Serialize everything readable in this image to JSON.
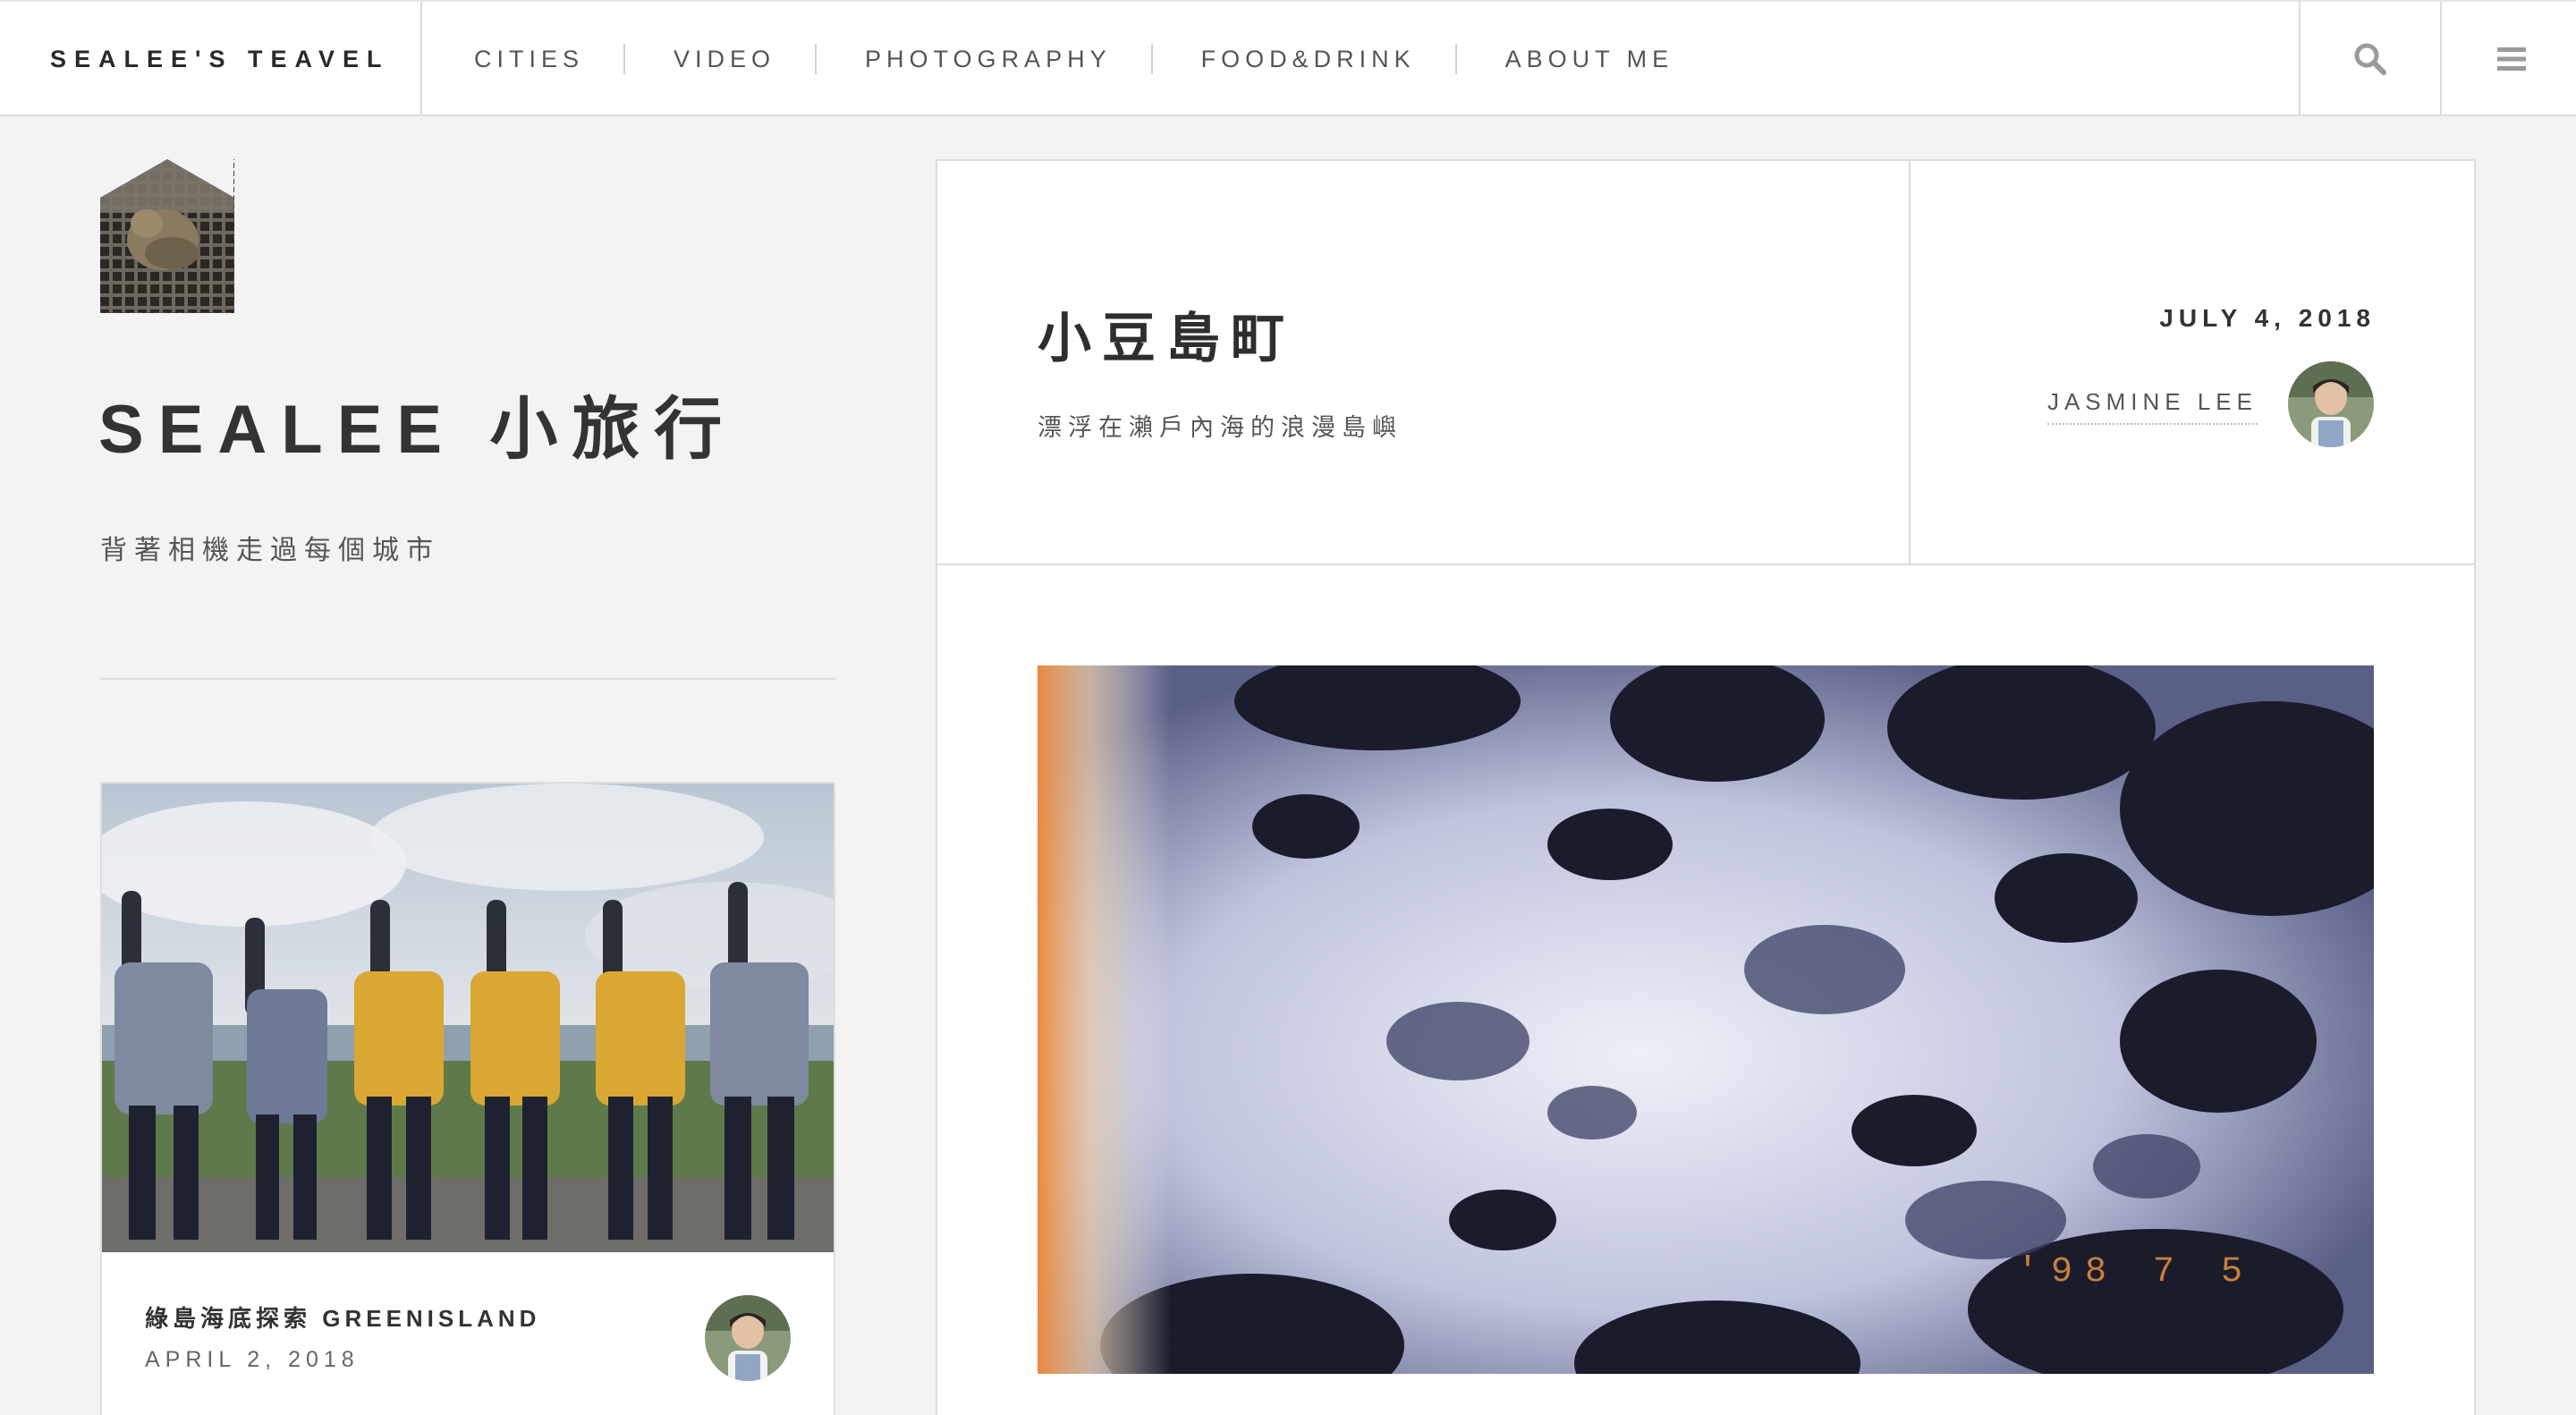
{
  "nav": {
    "brand": "SEALEE'S TEAVEL",
    "items": [
      "CITIES",
      "VIDEO",
      "PHOTOGRAPHY",
      "FOOD&DRINK",
      "ABOUT ME"
    ],
    "search_icon": "search-icon",
    "menu_icon": "hamburger-menu-icon"
  },
  "sidebar": {
    "title": "SEALEE 小旅行",
    "subtitle": "背著相機走過每個城市",
    "card": {
      "title": "綠島海底探索 GREENISLAND",
      "date": "APRIL 2, 2018"
    }
  },
  "post": {
    "title": "小豆島町",
    "subtitle": "漂浮在瀨戶內海的浪漫島嶼",
    "date": "JULY 4, 2018",
    "author": "JASMINE LEE",
    "photo_stamp": "'98 7 5"
  },
  "colors": {
    "background": "#f3f3f3",
    "panel": "#ffffff",
    "text": "#333333",
    "border": "#dcdcdc"
  }
}
